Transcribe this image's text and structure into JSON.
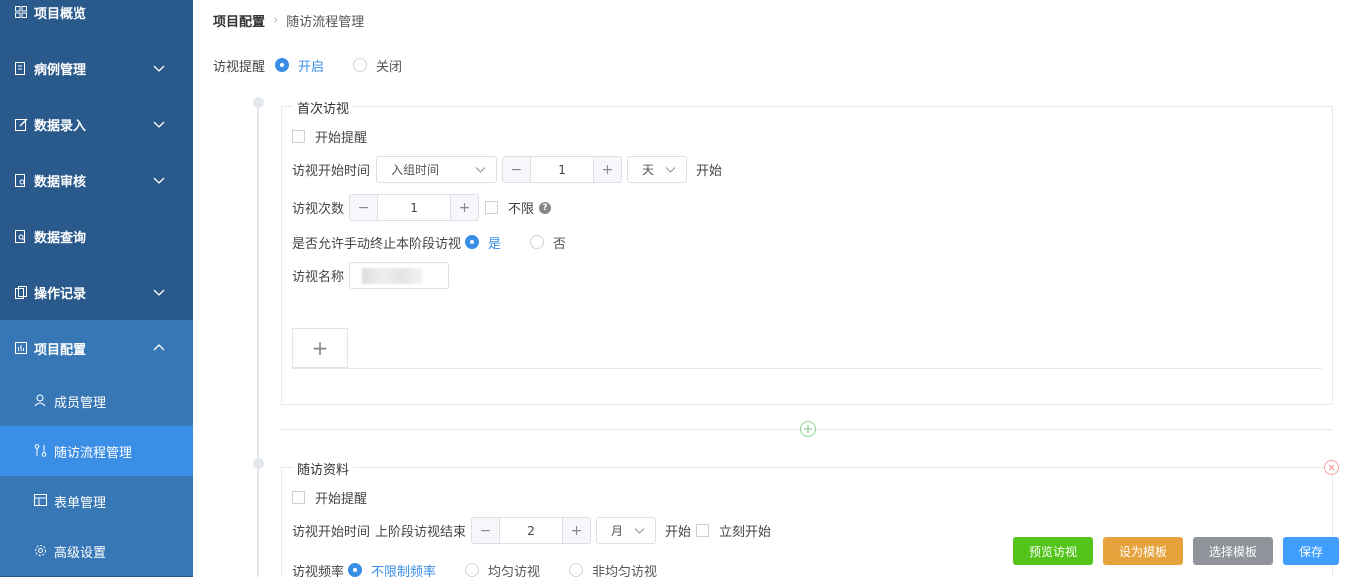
{
  "sidebar": {
    "items": [
      {
        "label": "项目概览",
        "icon": "grid-icon"
      },
      {
        "label": "病例管理",
        "icon": "case-icon"
      },
      {
        "label": "数据录入",
        "icon": "edit-icon"
      },
      {
        "label": "数据审核",
        "icon": "audit-icon"
      },
      {
        "label": "数据查询",
        "icon": "query-icon"
      },
      {
        "label": "操作记录",
        "icon": "record-icon"
      },
      {
        "label": "项目配置",
        "icon": "config-icon"
      }
    ],
    "subitems": [
      {
        "label": "成员管理",
        "icon": "user-icon"
      },
      {
        "label": "随访流程管理",
        "icon": "flow-icon"
      },
      {
        "label": "表单管理",
        "icon": "table-icon"
      },
      {
        "label": "高级设置",
        "icon": "gear-icon"
      }
    ]
  },
  "breadcrumb": {
    "root": "项目配置",
    "current": "随访流程管理"
  },
  "reminder": {
    "label": "访视提醒",
    "on": "开启",
    "off": "关闭",
    "selected": "开启"
  },
  "stage1": {
    "title": "首次访视",
    "start_reminder": "开始提醒",
    "start_time_label": "访视开始时间",
    "start_time_select": "入组时间",
    "start_offset": "1",
    "unit": "天",
    "start_suffix": "开始",
    "count_label": "访视次数",
    "count_value": "1",
    "unlimited": "不限",
    "help": "?",
    "manual_stop_label": "是否允许手动终止本阶段访视",
    "yes": "是",
    "no": "否",
    "name_label": "访视名称",
    "add": "+"
  },
  "stage2": {
    "title": "随访资料",
    "start_reminder": "开始提醒",
    "start_time_label": "访视开始时间",
    "start_time_from": "上阶段访视结束",
    "start_offset": "2",
    "unit": "月",
    "start_suffix": "开始",
    "immediate": "立刻开始",
    "freq_label": "访视频率",
    "freq_options": [
      "不限制频率",
      "均匀访视",
      "非均匀访视"
    ]
  },
  "buttons": {
    "preview": "预览访视",
    "set_template": "设为模板",
    "choose_template": "选择模板",
    "save": "保存"
  },
  "colors": {
    "sidebar": "#2a5a8c",
    "sidebar_open": "#3777b5",
    "active": "#3a8ee6",
    "preview": "#52c41a",
    "set_template": "#e6a23c",
    "choose_template": "#909399",
    "save": "#409eff"
  }
}
